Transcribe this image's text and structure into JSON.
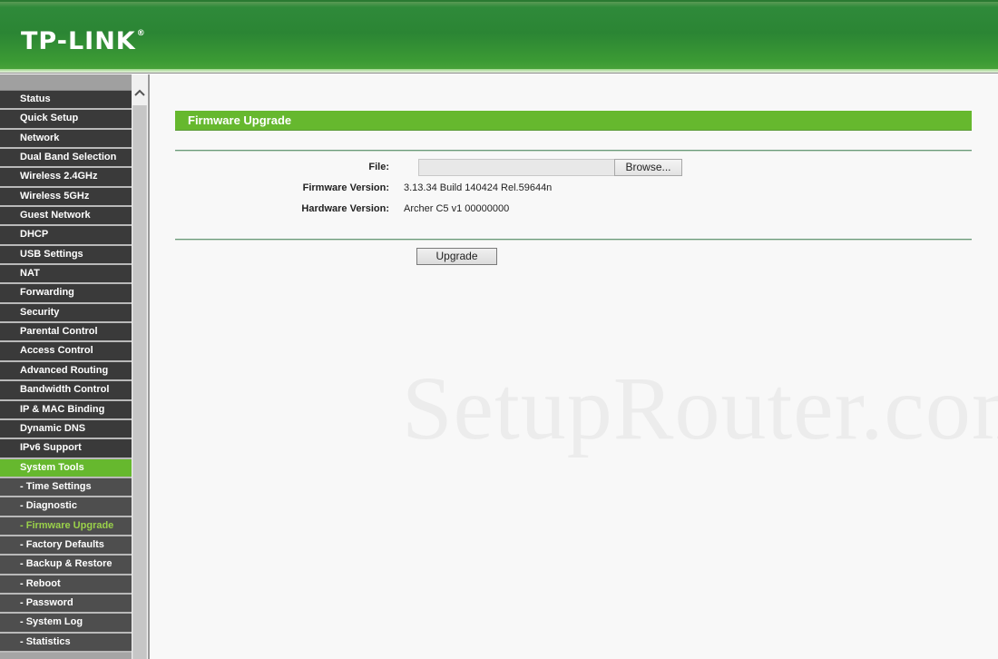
{
  "header": {
    "logo": "TP-LINK",
    "logo_mark": "®"
  },
  "sidebar": {
    "items": [
      {
        "label": "Status",
        "type": "main"
      },
      {
        "label": "Quick Setup",
        "type": "main"
      },
      {
        "label": "Network",
        "type": "main"
      },
      {
        "label": "Dual Band Selection",
        "type": "main"
      },
      {
        "label": "Wireless 2.4GHz",
        "type": "main"
      },
      {
        "label": "Wireless 5GHz",
        "type": "main"
      },
      {
        "label": "Guest Network",
        "type": "main"
      },
      {
        "label": "DHCP",
        "type": "main"
      },
      {
        "label": "USB Settings",
        "type": "main"
      },
      {
        "label": "NAT",
        "type": "main"
      },
      {
        "label": "Forwarding",
        "type": "main"
      },
      {
        "label": "Security",
        "type": "main"
      },
      {
        "label": "Parental Control",
        "type": "main"
      },
      {
        "label": "Access Control",
        "type": "main"
      },
      {
        "label": "Advanced Routing",
        "type": "main"
      },
      {
        "label": "Bandwidth Control",
        "type": "main"
      },
      {
        "label": "IP & MAC Binding",
        "type": "main"
      },
      {
        "label": "Dynamic DNS",
        "type": "main"
      },
      {
        "label": "IPv6 Support",
        "type": "main"
      },
      {
        "label": "System Tools",
        "type": "active"
      },
      {
        "label": "- Time Settings",
        "type": "sub"
      },
      {
        "label": "- Diagnostic",
        "type": "sub"
      },
      {
        "label": "- Firmware Upgrade",
        "type": "current"
      },
      {
        "label": "- Factory Defaults",
        "type": "sub"
      },
      {
        "label": "- Backup & Restore",
        "type": "sub"
      },
      {
        "label": "- Reboot",
        "type": "sub"
      },
      {
        "label": "- Password",
        "type": "sub"
      },
      {
        "label": "- System Log",
        "type": "sub"
      },
      {
        "label": "- Statistics",
        "type": "sub"
      }
    ],
    "scroll_up_icon": "^"
  },
  "main": {
    "title": "Firmware Upgrade",
    "file_label": "File:",
    "file_value": "",
    "browse_label": "Browse...",
    "firmware_label": "Firmware Version:",
    "firmware_value": "3.13.34 Build 140424 Rel.59644n",
    "hardware_label": "Hardware Version:",
    "hardware_value": "Archer C5 v1 00000000",
    "upgrade_label": "Upgrade"
  },
  "watermark": "SetupRouter.com"
}
